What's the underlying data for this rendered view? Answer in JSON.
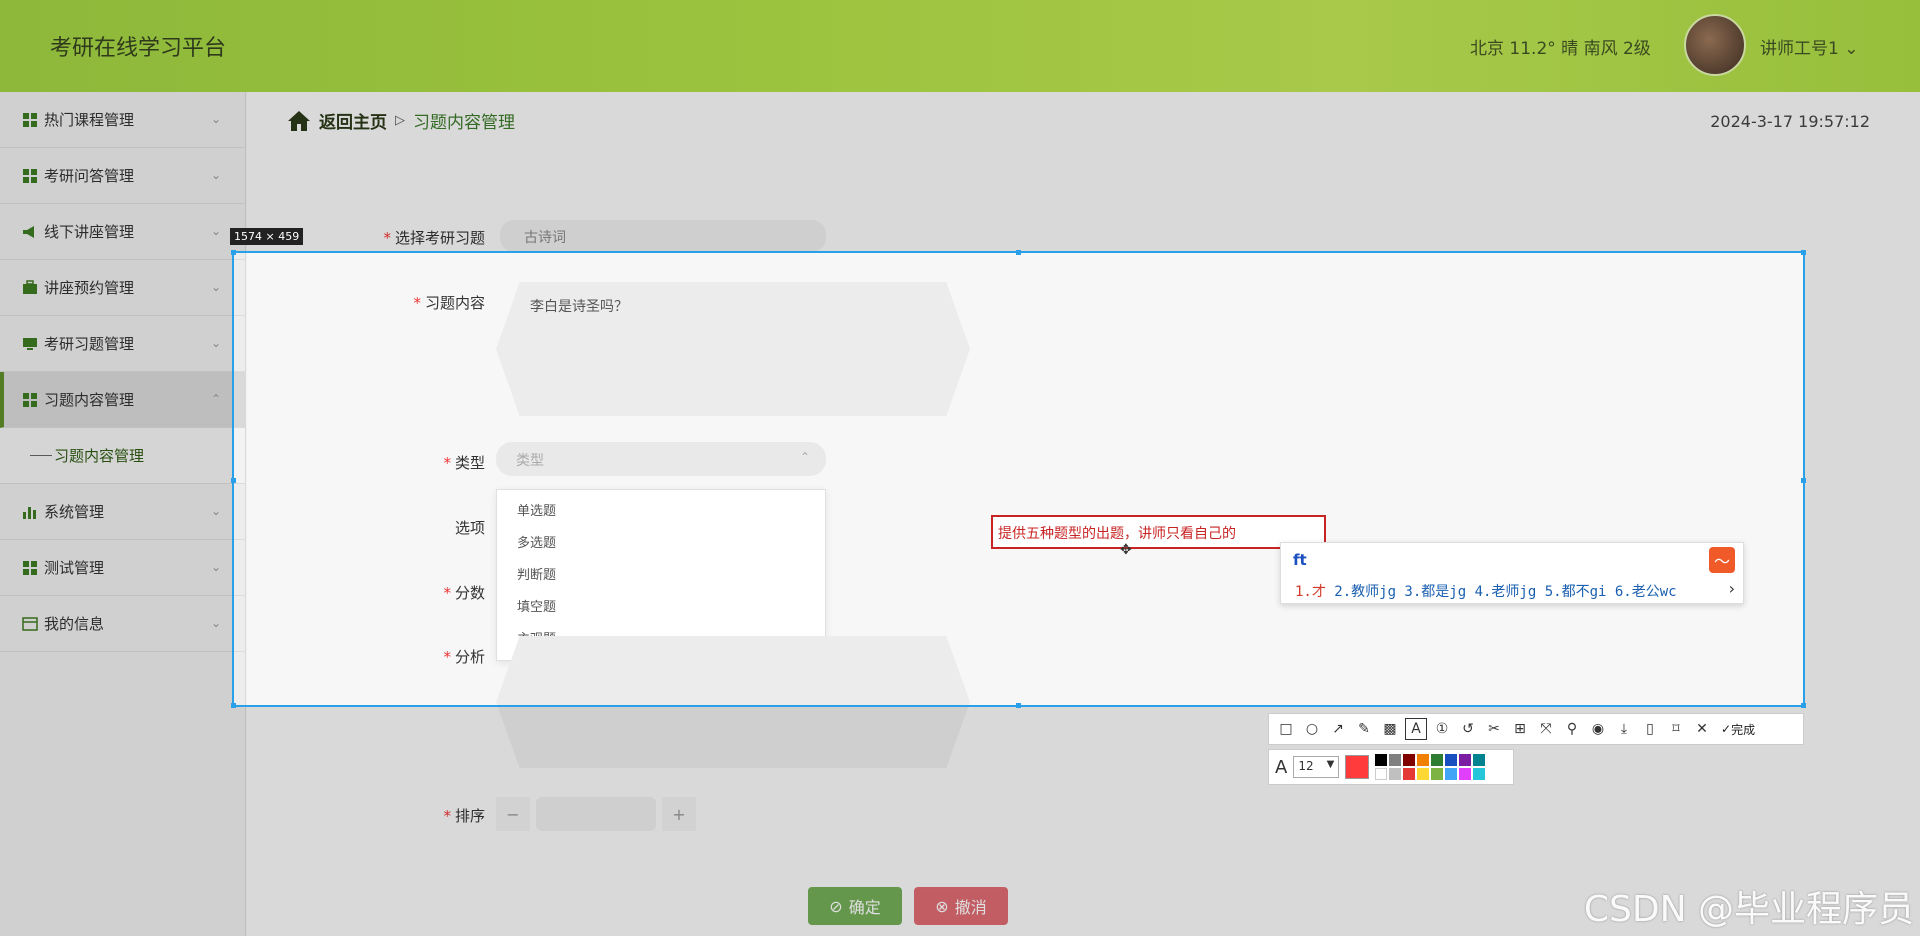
{
  "header": {
    "app_title": "考研在线学习平台",
    "weather": "北京 11.2° 晴 南风 2级",
    "user_name": "讲师工号1",
    "user_chevron": "⌄"
  },
  "sidebar": {
    "items": [
      {
        "label": "热门课程管理",
        "icon": "grid-icon"
      },
      {
        "label": "考研问答管理",
        "icon": "grid-icon"
      },
      {
        "label": "线下讲座管理",
        "icon": "megaphone-icon"
      },
      {
        "label": "讲座预约管理",
        "icon": "briefcase-icon"
      },
      {
        "label": "考研习题管理",
        "icon": "monitor-icon"
      },
      {
        "label": "习题内容管理",
        "icon": "grid-icon"
      },
      {
        "label": "系统管理",
        "icon": "bar-chart-icon"
      },
      {
        "label": "测试管理",
        "icon": "grid-icon"
      },
      {
        "label": "我的信息",
        "icon": "card-icon"
      }
    ],
    "sub_item": "习题内容管理"
  },
  "breadcrumb": {
    "back": "返回主页",
    "separator": "▷",
    "current": "习题内容管理"
  },
  "datetime": "2024-3-17 19:57:12",
  "form": {
    "required_mark": "*",
    "exam_label": "选择考研习题",
    "exam_value": "古诗词",
    "content_label": "习题内容",
    "content_value": "李白是诗圣吗？",
    "type_label": "类型",
    "type_placeholder": "类型",
    "options_label": "选项",
    "score_label": "分数",
    "analysis_label": "分析",
    "sort_label": "排序",
    "type_options": [
      "单选题",
      "多选题",
      "判断题",
      "填空题",
      "主观题"
    ],
    "stepper_minus": "−",
    "stepper_plus": "+",
    "confirm": "确定",
    "cancel": "撤消"
  },
  "overlay": {
    "size_tip": "1574 × 459",
    "annotation": "提供五种题型的出题，讲师只看自己的",
    "ime_typed": "ft",
    "ime_candidates_first": "1.才",
    "ime_candidates_rest": " 2.教师jg 3.都是jg 4.老师jg 5.都不gi 6.老公wc",
    "ime_next": "›",
    "toolbar_done": "完成",
    "font_size": "12",
    "colors": {
      "accent_blue": "#2aa0e8",
      "annotation_red": "#c82424"
    }
  },
  "watermark": "CSDN @毕业程序员"
}
